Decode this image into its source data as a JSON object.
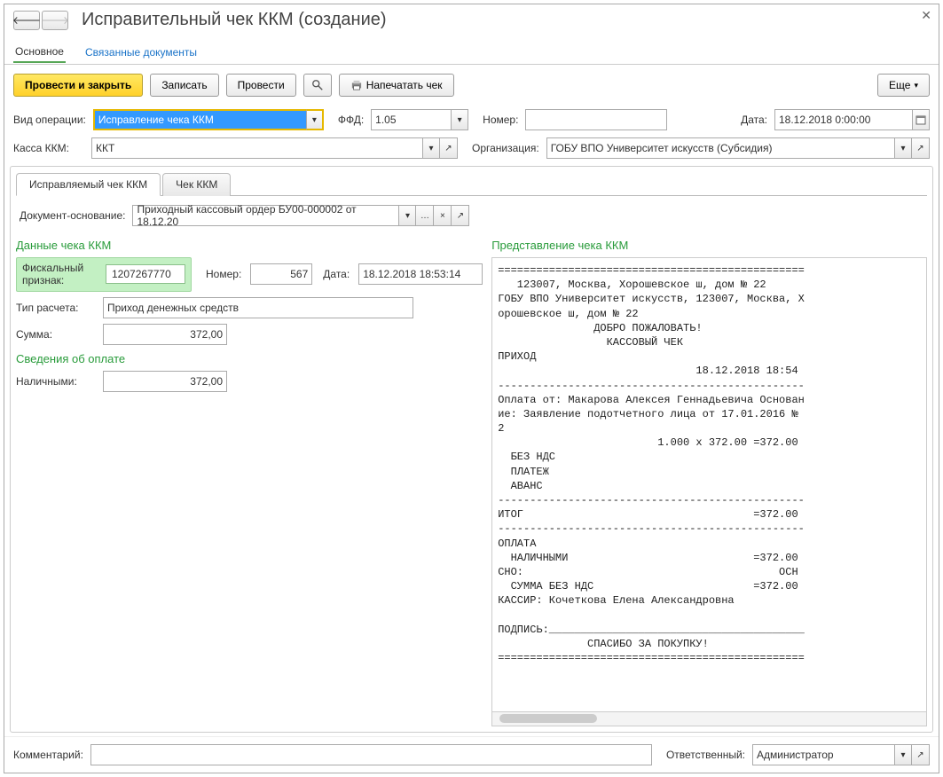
{
  "window": {
    "title": "Исправительный чек ККМ (создание)"
  },
  "mainTabs": {
    "primary": "Основное",
    "linked": "Связанные документы"
  },
  "toolbar": {
    "postClose": "Провести и закрыть",
    "save": "Записать",
    "post": "Провести",
    "print": "Напечатать чек",
    "more": "Еще"
  },
  "fields": {
    "opType": {
      "label": "Вид операции:",
      "value": "Исправление чека ККМ"
    },
    "ffd": {
      "label": "ФФД:",
      "value": "1.05"
    },
    "number": {
      "label": "Номер:",
      "value": ""
    },
    "date": {
      "label": "Дата:",
      "value": "18.12.2018  0:00:00"
    },
    "kassa": {
      "label": "Касса ККМ:",
      "value": "ККТ"
    },
    "org": {
      "label": "Организация:",
      "value": "ГОБУ ВПО Университет искусств (Субсидия)"
    }
  },
  "subTabs": {
    "corrected": "Исправляемый чек ККМ",
    "cheque": "Чек ККМ"
  },
  "basis": {
    "label": "Документ-основание:",
    "value": "Приходный кассовый ордер БУ00-000002 от 18.12.20"
  },
  "chequeData": {
    "sectionTitle": "Данные чека ККМ",
    "fpLabel": "Фискальный признак:",
    "fpValue": "1207267770",
    "numLabel": "Номер:",
    "numValue": "567",
    "dateLabel": "Дата:",
    "dateValue": "18.12.2018 18:53:14",
    "calcTypeLabel": "Тип расчета:",
    "calcTypeValue": "Приход денежных средств",
    "sumLabel": "Сумма:",
    "sumValue": "372,00"
  },
  "payment": {
    "sectionTitle": "Сведения об оплате",
    "cashLabel": "Наличными:",
    "cashValue": "372,00"
  },
  "receipt": {
    "sectionTitle": "Представление чека ККМ",
    "text": "================================================\n   123007, Москва, Хорошевское ш, дом № 22\nГОБУ ВПО Университет искусств, 123007, Москва, Х\nорошевское ш, дом № 22\n               ДОБРО ПОЖАЛОВАТЬ!\n                 КАССОВЫЙ ЧЕК\nПРИХОД\n                               18.12.2018 18:54\n------------------------------------------------\nОплата от: Макарова Алексея Геннадьевича Основан\nие: Заявление подотчетного лица от 17.01.2016 №\n2\n                         1.000 x 372.00 =372.00\n  БЕЗ НДС\n  ПЛАТЕЖ\n  АВАНС\n------------------------------------------------\nИТОГ                                    =372.00\n------------------------------------------------\nОПЛАТА\n  НАЛИЧНЫМИ                             =372.00\nСНО:                                        ОСН\n  СУММА БЕЗ НДС                         =372.00\nКАССИР: Кочеткова Елена Александровна\n\nПОДПИСЬ:________________________________________\n              СПАСИБО ЗА ПОКУПКУ!\n================================================"
  },
  "footer": {
    "commentLabel": "Комментарий:",
    "commentValue": "",
    "respLabel": "Ответственный:",
    "respValue": "Администратор"
  }
}
